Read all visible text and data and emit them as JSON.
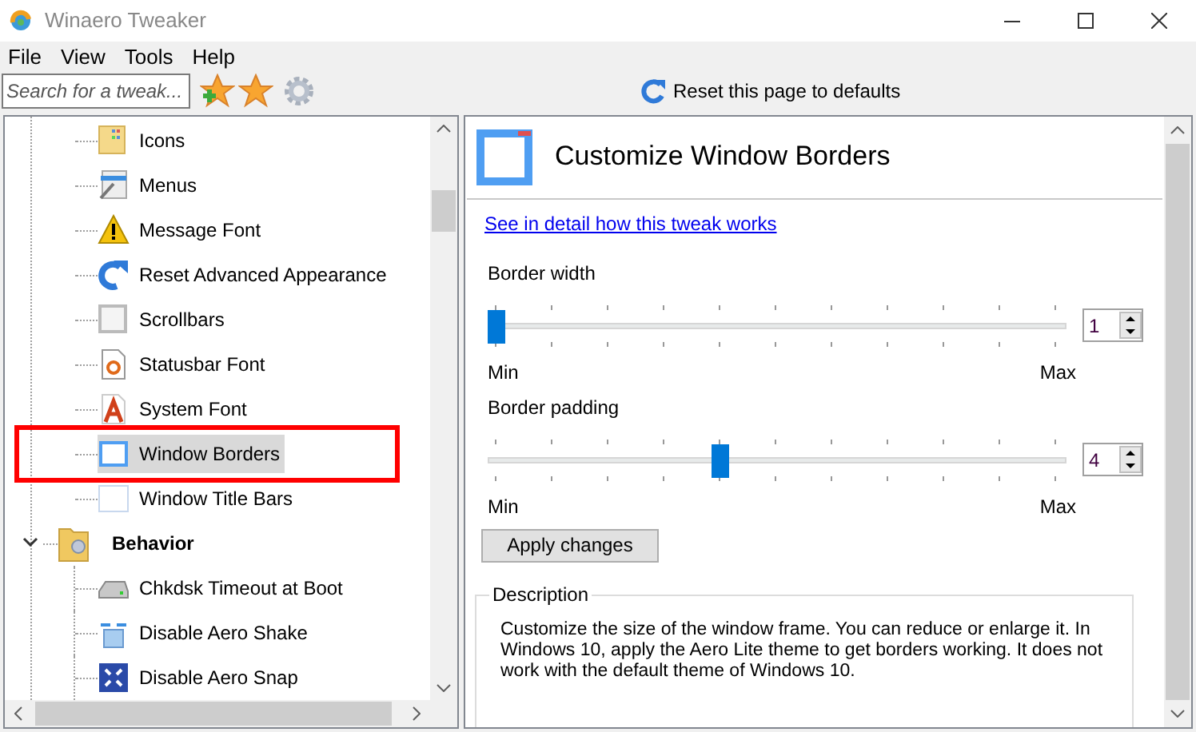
{
  "window": {
    "title": "Winaero Tweaker"
  },
  "menu": [
    "File",
    "View",
    "Tools",
    "Help"
  ],
  "toolbar": {
    "search": {
      "placeholder": "Search for a tweak..."
    },
    "reset_button": "Reset this page to defaults"
  },
  "tree": [
    {
      "label": "Icons",
      "selected": false,
      "highlighted": false
    },
    {
      "label": "Menus",
      "selected": false,
      "highlighted": false
    },
    {
      "label": "Message Font",
      "selected": false,
      "highlighted": false
    },
    {
      "label": "Reset Advanced Appearance",
      "selected": false,
      "highlighted": false
    },
    {
      "label": "Scrollbars",
      "selected": false,
      "highlighted": false
    },
    {
      "label": "Statusbar Font",
      "selected": false,
      "highlighted": false
    },
    {
      "label": "System Font",
      "selected": false,
      "highlighted": false
    },
    {
      "label": "Window Borders",
      "selected": true,
      "highlighted": true
    },
    {
      "label": "Window Title Bars",
      "selected": false,
      "highlighted": false
    },
    {
      "label": "Behavior",
      "kind": "group",
      "expanded": true,
      "children": [
        {
          "label": "Chkdsk Timeout at Boot",
          "selected": false,
          "highlighted": false
        },
        {
          "label": "Disable Aero Shake",
          "selected": false,
          "highlighted": false
        },
        {
          "label": "Disable Aero Snap",
          "selected": false,
          "highlighted": false
        }
      ]
    }
  ],
  "page": {
    "title": "Customize Window Borders",
    "link": "See in detail how this tweak works",
    "sliders": [
      {
        "label": "Border width",
        "level": 0,
        "value": "1",
        "min": "Min",
        "max": "Max"
      },
      {
        "label": "Border padding",
        "level": 0.4,
        "value": "4",
        "min": "Min",
        "max": "Max"
      }
    ],
    "apply_button": "Apply changes",
    "description": {
      "title": "Description",
      "text": "Customize the size of the window frame. You can reduce or enlarge it. In Windows 10, apply the Aero Lite theme to get borders working. It does not work with the default theme of Windows 10."
    }
  }
}
